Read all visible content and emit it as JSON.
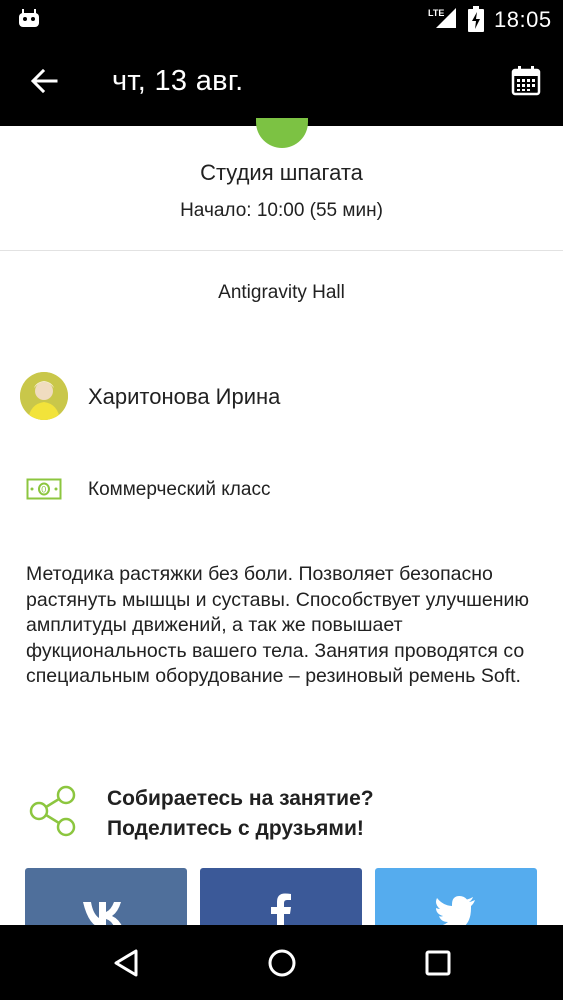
{
  "status_bar": {
    "network": "LTE",
    "time": "18:05"
  },
  "app_bar": {
    "title": "чт, 13 авг."
  },
  "class": {
    "name": "Студия шпагата",
    "start": "Начало: 10:00 (55 мин)",
    "hall": "Antigravity Hall",
    "accent_color": "#7cc243"
  },
  "trainer": {
    "name": "Харитонова Ирина"
  },
  "class_type": {
    "label": "Коммерческий класс",
    "icon": "money-icon",
    "icon_color": "#8cc63f"
  },
  "description": "Методика растяжки без боли. Позволяет безопасно растянуть мышцы и суставы. Способствует улучшению амплитуды движений, а так же повышает фукциональность вашего тела. Занятия проводятся со специальным оборудование – резиновый ремень Soft.",
  "share": {
    "line1": "Собираетесь на занятие?",
    "line2": "Поделитесь с друзьями!",
    "icon": "share-icon",
    "icon_color": "#8cc63f"
  },
  "social_buttons": [
    {
      "network": "vk",
      "icon": "vk-icon",
      "color": "#4f6f9b"
    },
    {
      "network": "facebook",
      "icon": "facebook-icon",
      "color": "#3b5998"
    },
    {
      "network": "twitter",
      "icon": "twitter-icon",
      "color": "#55acee"
    }
  ],
  "nav_bar": {
    "icons": [
      "back-triangle-icon",
      "home-circle-icon",
      "recents-square-icon"
    ]
  }
}
